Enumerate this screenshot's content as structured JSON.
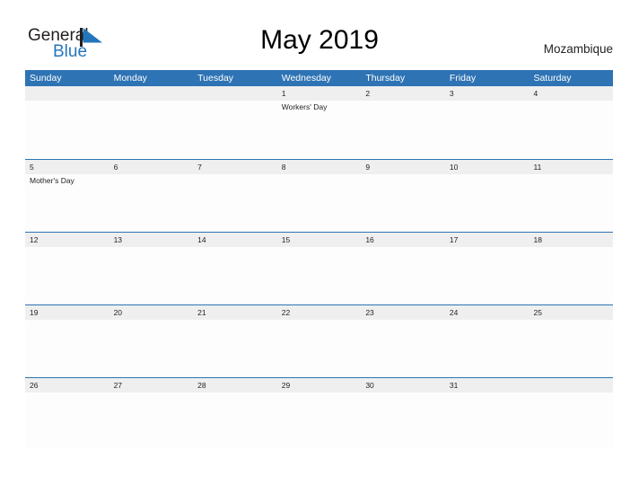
{
  "brand": {
    "name_part1": "General",
    "name_part2": "Blue",
    "flag_icon": "triangle-flag-icon",
    "accent_color": "#2476bc"
  },
  "header": {
    "title": "May 2019",
    "country": "Mozambique"
  },
  "theme": {
    "header_blue": "#2e73b4",
    "date_band_gray": "#efefef",
    "body_white": "#fdfdfd",
    "text_dark": "#231f20"
  },
  "calendar": {
    "month": "May",
    "year": "2019",
    "weekday_headers": [
      "Sunday",
      "Monday",
      "Tuesday",
      "Wednesday",
      "Thursday",
      "Friday",
      "Saturday"
    ],
    "weeks": [
      {
        "days": [
          {
            "num": "",
            "event": ""
          },
          {
            "num": "",
            "event": ""
          },
          {
            "num": "",
            "event": ""
          },
          {
            "num": "1",
            "event": "Workers' Day"
          },
          {
            "num": "2",
            "event": ""
          },
          {
            "num": "3",
            "event": ""
          },
          {
            "num": "4",
            "event": ""
          }
        ]
      },
      {
        "days": [
          {
            "num": "5",
            "event": "Mother's Day"
          },
          {
            "num": "6",
            "event": ""
          },
          {
            "num": "7",
            "event": ""
          },
          {
            "num": "8",
            "event": ""
          },
          {
            "num": "9",
            "event": ""
          },
          {
            "num": "10",
            "event": ""
          },
          {
            "num": "11",
            "event": ""
          }
        ]
      },
      {
        "days": [
          {
            "num": "12",
            "event": ""
          },
          {
            "num": "13",
            "event": ""
          },
          {
            "num": "14",
            "event": ""
          },
          {
            "num": "15",
            "event": ""
          },
          {
            "num": "16",
            "event": ""
          },
          {
            "num": "17",
            "event": ""
          },
          {
            "num": "18",
            "event": ""
          }
        ]
      },
      {
        "days": [
          {
            "num": "19",
            "event": ""
          },
          {
            "num": "20",
            "event": ""
          },
          {
            "num": "21",
            "event": ""
          },
          {
            "num": "22",
            "event": ""
          },
          {
            "num": "23",
            "event": ""
          },
          {
            "num": "24",
            "event": ""
          },
          {
            "num": "25",
            "event": ""
          }
        ]
      },
      {
        "days": [
          {
            "num": "26",
            "event": ""
          },
          {
            "num": "27",
            "event": ""
          },
          {
            "num": "28",
            "event": ""
          },
          {
            "num": "29",
            "event": ""
          },
          {
            "num": "30",
            "event": ""
          },
          {
            "num": "31",
            "event": ""
          },
          {
            "num": "",
            "event": ""
          }
        ]
      }
    ]
  }
}
